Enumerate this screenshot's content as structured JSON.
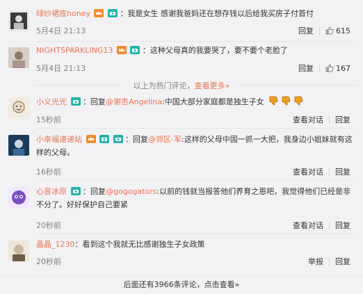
{
  "comments": [
    {
      "username": "绿纱裙底honey",
      "text": "我是女生 感谢我爸妈还在想存钱以后给我买房子付首付",
      "time": "5月4日 21:13",
      "reply_label": "回复",
      "likes": "615",
      "avatar_colors": [
        "#2a2a2a",
        "#5a5a5a",
        "#e8e8e8"
      ],
      "badges": [
        "vip-crown-icon",
        "camera-member-icon"
      ]
    },
    {
      "username": "NIGHTSPARKLING13",
      "text": "这种父母真的我要哭了，要不要个老脸了",
      "time": "5月4日 21:13",
      "reply_label": "回复",
      "likes": "167",
      "avatar_colors": [
        "#b8a59a",
        "#8c7a70",
        "#e0d6cf"
      ],
      "badges": [
        "vip-crown-icon",
        "camera-member-icon"
      ]
    },
    {
      "username": "小义光光",
      "reply_prefix": "回复",
      "mention": "@谢杏Angelina",
      "text": ":中国大部分家庭都是独生子女",
      "time": "15秒前",
      "view_thread_label": "查看对话",
      "reply_label": "回复",
      "avatar_colors": [
        "#e6d9c8",
        "#8a6a4a",
        "#f2ebe0"
      ],
      "badges": [
        "camera-member-icon"
      ],
      "emoji": [
        "thumbs-down-icon",
        "thumbs-down-icon",
        "thumbs-down-icon"
      ]
    },
    {
      "username": "小幸福速递站",
      "reply_prefix": "回复",
      "mention": "@郊区-军",
      "text": ":这样的父母中国一抓一大把，我身边小姐妹就有这样的父母。",
      "time": "16秒前",
      "view_thread_label": "查看对话",
      "reply_label": "回复",
      "avatar_colors": [
        "#1b3b5a",
        "#c9d6e2",
        "#3a6a9a"
      ],
      "badges": [
        "vip-crown-icon",
        "camera-member-icon",
        "camera-member-icon"
      ]
    },
    {
      "username": "心音冰原",
      "reply_prefix": "回复",
      "mention": "@gogogators",
      "text": ":以前的钱就当报答他们养育之恩吧，我觉得他们已经是非不分了。好好保护自己要紧",
      "time": "20秒前",
      "view_thread_label": "查看对话",
      "reply_label": "回复",
      "avatar_colors": [
        "#7a4fc2",
        "#f2e8ff",
        "#3a2a6a"
      ],
      "badges": [
        "camera-member-icon"
      ]
    },
    {
      "username": "晶晶_1230",
      "text": "看到这个我就无比感谢独生子女政策",
      "time": "20秒前",
      "report_label": "举报",
      "reply_label": "回复",
      "avatar_colors": [
        "#c9b8a0",
        "#6a5a48",
        "#efe6da"
      ],
      "badges": []
    }
  ],
  "hot_section": {
    "label": "以上为热门评论，",
    "more_link": "查看更多",
    "more_arrow": "»"
  },
  "footer": {
    "text": "后面还有3966条评论，点击查看",
    "arrow": "»"
  },
  "colors": {
    "accent": "#eb7350",
    "background": "#f2f2f5",
    "muted": "#808080",
    "badge_orange": "#f08c2e",
    "badge_teal": "#26b4a8"
  }
}
